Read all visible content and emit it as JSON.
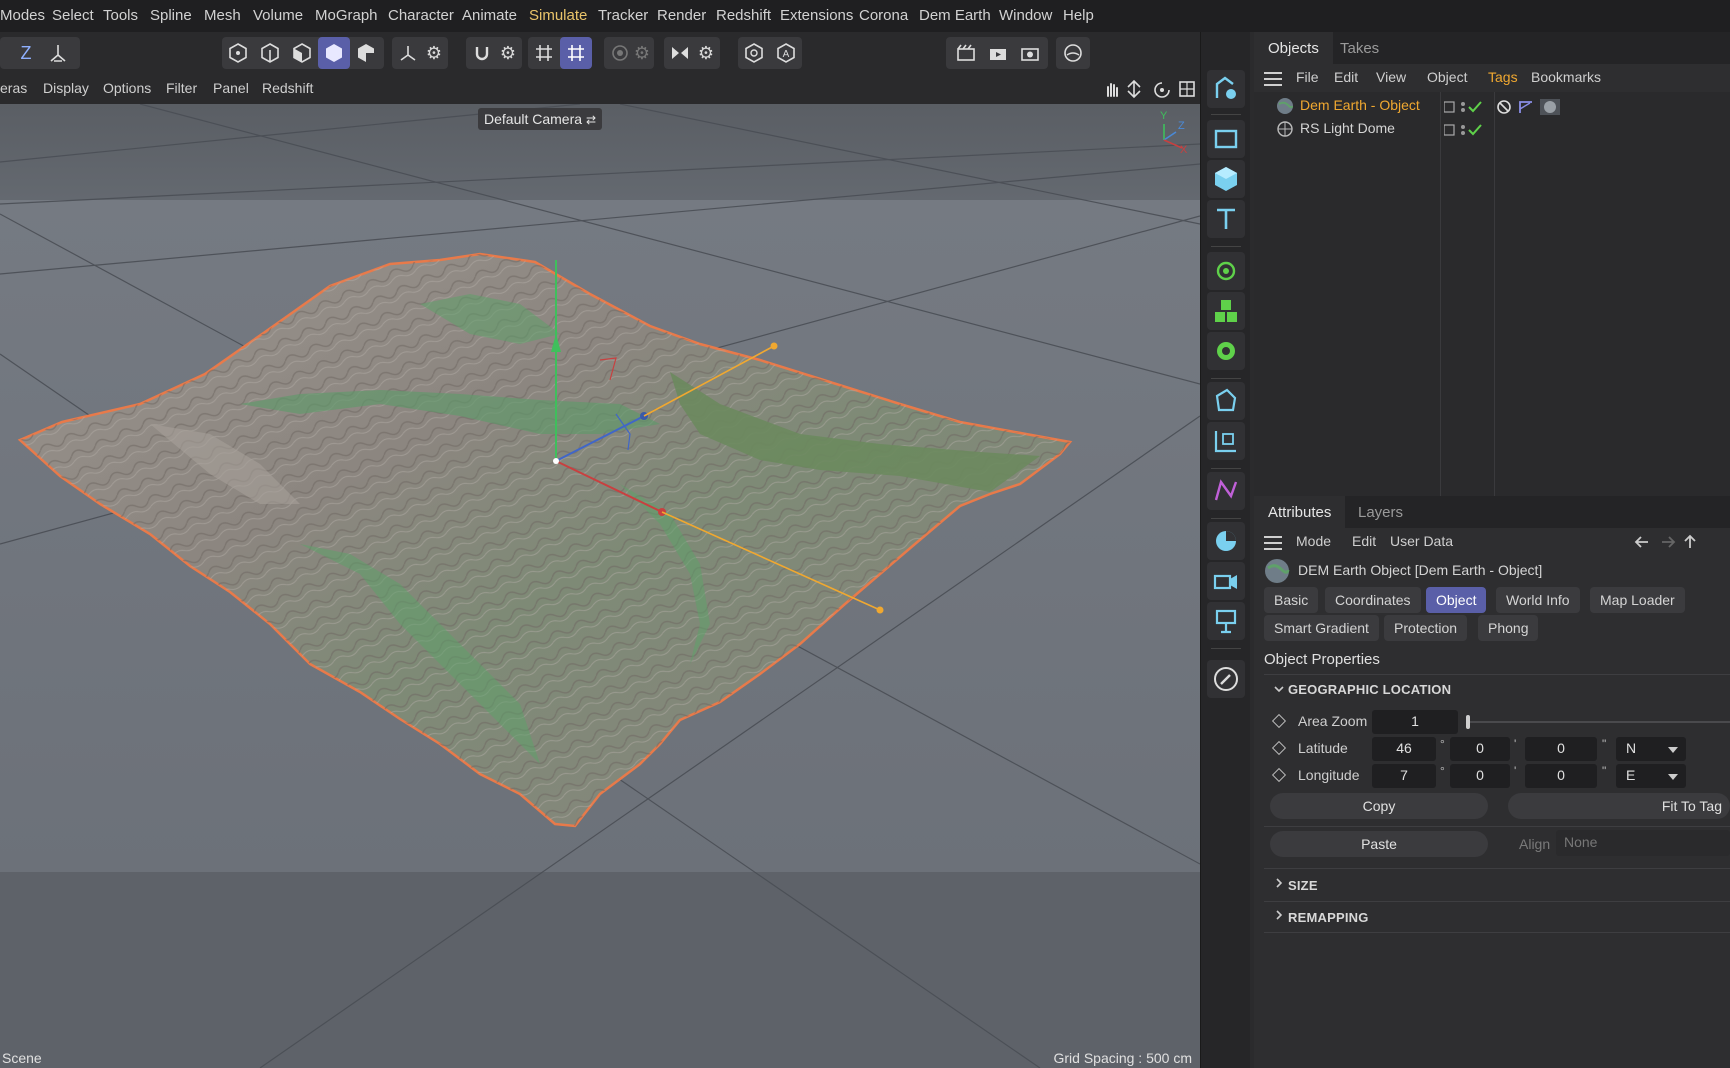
{
  "menubar": {
    "items": [
      "Modes",
      "Select",
      "Tools",
      "Spline",
      "Mesh",
      "Volume",
      "MoGraph",
      "Character",
      "Animate",
      "Simulate",
      "Tracker",
      "Render",
      "Redshift",
      "Extensions",
      "Corona",
      "Dem Earth",
      "Window",
      "Help"
    ],
    "active": "Simulate"
  },
  "toolbar": {
    "z_label": "Z"
  },
  "viewport": {
    "menu": [
      "eras",
      "Display",
      "Options",
      "Filter",
      "Panel",
      "Redshift"
    ],
    "camera": "Default Camera",
    "status_left": "Scene",
    "status_right": "Grid Spacing : 500 cm",
    "gizmo": {
      "y": "Y",
      "z": "Z",
      "x": "X"
    }
  },
  "objects_panel": {
    "tabs": [
      "Objects",
      "Takes"
    ],
    "menu": [
      "File",
      "Edit",
      "View",
      "Object",
      "Tags",
      "Bookmarks"
    ],
    "rows": [
      {
        "name": "Dem Earth - Object",
        "selected": true
      },
      {
        "name": "RS Light Dome",
        "selected": false
      }
    ]
  },
  "attributes_panel": {
    "tabs": [
      "Attributes",
      "Layers"
    ],
    "menu": [
      "Mode",
      "Edit",
      "User Data"
    ],
    "object_title": "DEM Earth Object [Dem Earth - Object]",
    "attr_tabs_row1": [
      "Basic",
      "Coordinates",
      "Object",
      "World Info",
      "Map Loader"
    ],
    "attr_tabs_row2": [
      "Smart Gradient",
      "Protection",
      "Phong"
    ],
    "active_tab": "Object",
    "section": "Object Properties",
    "group": "GEOGRAPHIC LOCATION",
    "area_zoom": {
      "label": "Area Zoom",
      "value": "1"
    },
    "latitude": {
      "label": "Latitude",
      "deg": "46",
      "min": "0",
      "sec": "0",
      "hemi": "N"
    },
    "longitude": {
      "label": "Longitude",
      "deg": "7",
      "min": "0",
      "sec": "0",
      "hemi": "E"
    },
    "units": {
      "deg": "°",
      "min": "'",
      "sec": "\""
    },
    "buttons": {
      "copy": "Copy",
      "paste": "Paste",
      "fit": "Fit To Tag"
    },
    "align": {
      "label": "Align",
      "value": "None"
    },
    "collapsed_groups": [
      "SIZE",
      "REMAPPING"
    ]
  },
  "colors": {
    "accent": "#5a5fa8",
    "selected_object": "#f0a830",
    "terrain_outline": "#e87a4a",
    "palette_icon": "#7ad0ef",
    "palette_green": "#5fd14a",
    "palette_magenta": "#c060d8"
  }
}
